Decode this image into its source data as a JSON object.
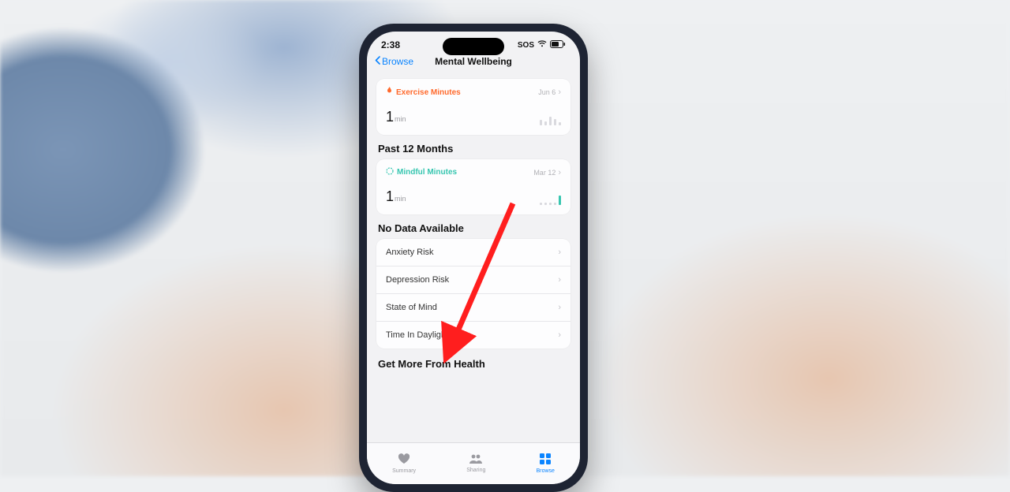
{
  "status": {
    "time": "2:38",
    "sos": "SOS"
  },
  "nav": {
    "back": "Browse",
    "title": "Mental Wellbeing"
  },
  "card_exercise": {
    "label": "Exercise Minutes",
    "date": "Jun 6",
    "value": "1",
    "unit": "min"
  },
  "section_past12": "Past 12 Months",
  "card_mindful": {
    "label": "Mindful Minutes",
    "date": "Mar 12",
    "value": "1",
    "unit": "min"
  },
  "section_nodata": "No Data Available",
  "nodata_rows": [
    "Anxiety Risk",
    "Depression Risk",
    "State of Mind",
    "Time In Daylight"
  ],
  "section_more": "Get More From Health",
  "tabs": {
    "summary": "Summary",
    "sharing": "Sharing",
    "browse": "Browse"
  }
}
